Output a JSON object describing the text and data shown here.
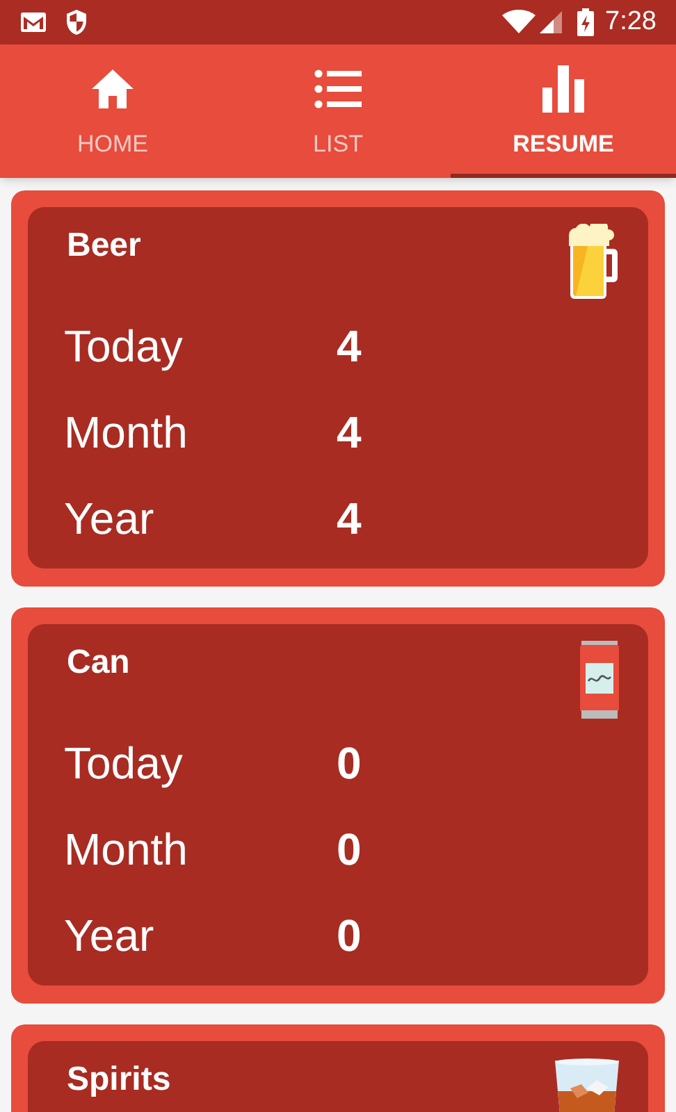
{
  "status_bar": {
    "time": "7:28"
  },
  "tabs": [
    {
      "kind": "home",
      "label": "HOME",
      "selected": false
    },
    {
      "kind": "list",
      "label": "LIST",
      "selected": false
    },
    {
      "kind": "chart",
      "label": "RESUME",
      "selected": true
    }
  ],
  "cards": [
    {
      "kind": "beer",
      "title": "Beer",
      "rows": [
        {
          "label": "Today",
          "value": "4"
        },
        {
          "label": "Month",
          "value": "4"
        },
        {
          "label": "Year",
          "value": "4"
        }
      ]
    },
    {
      "kind": "can",
      "title": "Can",
      "rows": [
        {
          "label": "Today",
          "value": "0"
        },
        {
          "label": "Month",
          "value": "0"
        },
        {
          "label": "Year",
          "value": "0"
        }
      ]
    },
    {
      "kind": "spirits",
      "title": "Spirits"
    }
  ]
}
